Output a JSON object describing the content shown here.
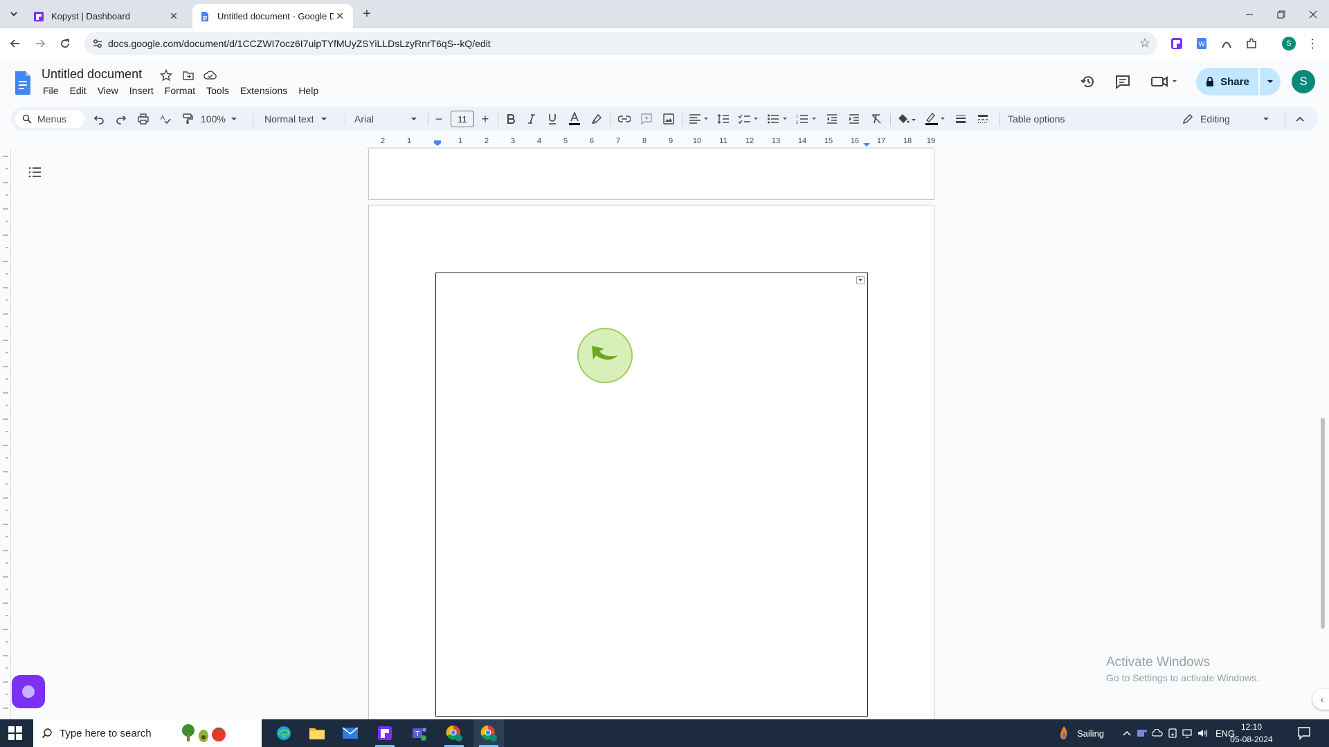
{
  "browser": {
    "tabs": [
      {
        "title": "Kopyst | Dashboard",
        "active": false
      },
      {
        "title": "Untitled document - Google Do",
        "active": true
      }
    ],
    "url": "docs.google.com/document/d/1CCZWI7ocz6I7uipTYfMUyZSYiLLDsLzyRnrT6qS--kQ/edit",
    "profile_initial": "S"
  },
  "docs": {
    "title": "Untitled document",
    "menu": [
      "File",
      "Edit",
      "View",
      "Insert",
      "Format",
      "Tools",
      "Extensions",
      "Help"
    ],
    "share_label": "Share",
    "avatar_initial": "S"
  },
  "toolbar": {
    "menus_label": "Menus",
    "zoom": "100%",
    "style": "Normal text",
    "font": "Arial",
    "font_size": "11",
    "table_options": "Table options",
    "mode": "Editing"
  },
  "ruler": {
    "numbers": [
      "2",
      "1",
      "1",
      "2",
      "3",
      "4",
      "5",
      "6",
      "7",
      "8",
      "9",
      "10",
      "11",
      "12",
      "13",
      "14",
      "15",
      "16",
      "17",
      "18",
      "19"
    ]
  },
  "watermark": {
    "title": "Activate Windows",
    "subtitle": "Go to Settings to activate Windows."
  },
  "taskbar": {
    "search_placeholder": "Type here to search",
    "weather": "Sailing",
    "language": "ENG",
    "time": "12:10",
    "date": "05-08-2024"
  },
  "colors": {
    "share_bg": "#c2e7ff",
    "docs_blue": "#4285f4",
    "avatar": "#0b8a7a",
    "taskbar": "#1c2b3e"
  }
}
